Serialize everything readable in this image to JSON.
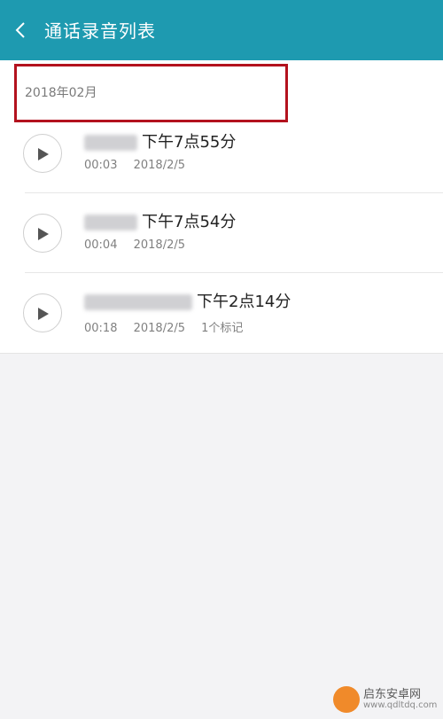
{
  "header": {
    "title": "通话录音列表",
    "icon": "back-arrow-icon",
    "background": "#1e9ab0"
  },
  "section": {
    "label": "2018年02月"
  },
  "recordings": [
    {
      "time_label": "下午7点55分",
      "duration": "00:03",
      "date": "2018/2/5",
      "marks": ""
    },
    {
      "time_label": "下午7点54分",
      "duration": "00:04",
      "date": "2018/2/5",
      "marks": ""
    },
    {
      "time_label": "下午2点14分",
      "duration": "00:18",
      "date": "2018/2/5",
      "marks": "1个标记"
    }
  ],
  "watermark": {
    "title": "启东安卓网",
    "url": "www.qdltdq.com"
  },
  "colors": {
    "highlight": "#b3121e",
    "accent": "#1e9ab0"
  }
}
